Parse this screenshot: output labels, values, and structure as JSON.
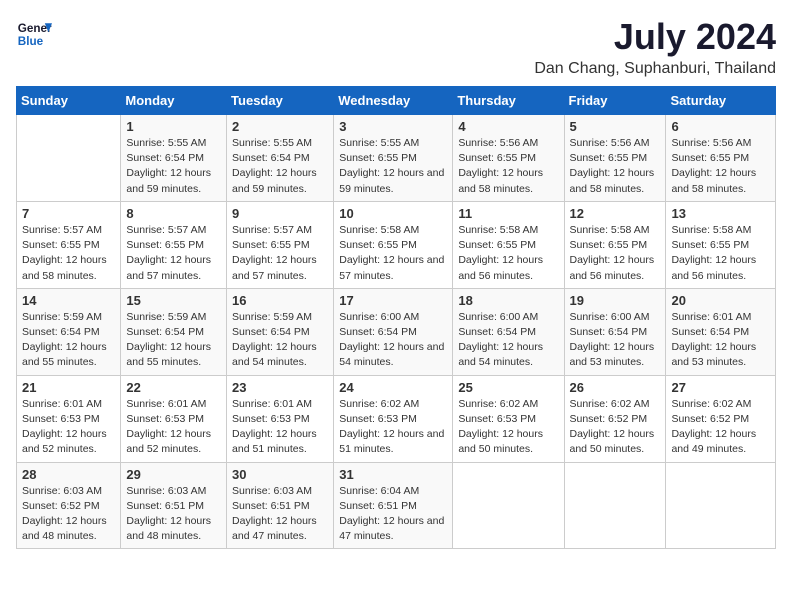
{
  "app": {
    "name_line1": "General",
    "name_line2": "Blue"
  },
  "calendar": {
    "title": "July 2024",
    "location": "Dan Chang, Suphanburi, Thailand",
    "days_of_week": [
      "Sunday",
      "Monday",
      "Tuesday",
      "Wednesday",
      "Thursday",
      "Friday",
      "Saturday"
    ],
    "weeks": [
      [
        {
          "day": "",
          "sunrise": "",
          "sunset": "",
          "daylight": ""
        },
        {
          "day": "1",
          "sunrise": "Sunrise: 5:55 AM",
          "sunset": "Sunset: 6:54 PM",
          "daylight": "Daylight: 12 hours and 59 minutes."
        },
        {
          "day": "2",
          "sunrise": "Sunrise: 5:55 AM",
          "sunset": "Sunset: 6:54 PM",
          "daylight": "Daylight: 12 hours and 59 minutes."
        },
        {
          "day": "3",
          "sunrise": "Sunrise: 5:55 AM",
          "sunset": "Sunset: 6:55 PM",
          "daylight": "Daylight: 12 hours and 59 minutes."
        },
        {
          "day": "4",
          "sunrise": "Sunrise: 5:56 AM",
          "sunset": "Sunset: 6:55 PM",
          "daylight": "Daylight: 12 hours and 58 minutes."
        },
        {
          "day": "5",
          "sunrise": "Sunrise: 5:56 AM",
          "sunset": "Sunset: 6:55 PM",
          "daylight": "Daylight: 12 hours and 58 minutes."
        },
        {
          "day": "6",
          "sunrise": "Sunrise: 5:56 AM",
          "sunset": "Sunset: 6:55 PM",
          "daylight": "Daylight: 12 hours and 58 minutes."
        }
      ],
      [
        {
          "day": "7",
          "sunrise": "Sunrise: 5:57 AM",
          "sunset": "Sunset: 6:55 PM",
          "daylight": "Daylight: 12 hours and 58 minutes."
        },
        {
          "day": "8",
          "sunrise": "Sunrise: 5:57 AM",
          "sunset": "Sunset: 6:55 PM",
          "daylight": "Daylight: 12 hours and 57 minutes."
        },
        {
          "day": "9",
          "sunrise": "Sunrise: 5:57 AM",
          "sunset": "Sunset: 6:55 PM",
          "daylight": "Daylight: 12 hours and 57 minutes."
        },
        {
          "day": "10",
          "sunrise": "Sunrise: 5:58 AM",
          "sunset": "Sunset: 6:55 PM",
          "daylight": "Daylight: 12 hours and 57 minutes."
        },
        {
          "day": "11",
          "sunrise": "Sunrise: 5:58 AM",
          "sunset": "Sunset: 6:55 PM",
          "daylight": "Daylight: 12 hours and 56 minutes."
        },
        {
          "day": "12",
          "sunrise": "Sunrise: 5:58 AM",
          "sunset": "Sunset: 6:55 PM",
          "daylight": "Daylight: 12 hours and 56 minutes."
        },
        {
          "day": "13",
          "sunrise": "Sunrise: 5:58 AM",
          "sunset": "Sunset: 6:55 PM",
          "daylight": "Daylight: 12 hours and 56 minutes."
        }
      ],
      [
        {
          "day": "14",
          "sunrise": "Sunrise: 5:59 AM",
          "sunset": "Sunset: 6:54 PM",
          "daylight": "Daylight: 12 hours and 55 minutes."
        },
        {
          "day": "15",
          "sunrise": "Sunrise: 5:59 AM",
          "sunset": "Sunset: 6:54 PM",
          "daylight": "Daylight: 12 hours and 55 minutes."
        },
        {
          "day": "16",
          "sunrise": "Sunrise: 5:59 AM",
          "sunset": "Sunset: 6:54 PM",
          "daylight": "Daylight: 12 hours and 54 minutes."
        },
        {
          "day": "17",
          "sunrise": "Sunrise: 6:00 AM",
          "sunset": "Sunset: 6:54 PM",
          "daylight": "Daylight: 12 hours and 54 minutes."
        },
        {
          "day": "18",
          "sunrise": "Sunrise: 6:00 AM",
          "sunset": "Sunset: 6:54 PM",
          "daylight": "Daylight: 12 hours and 54 minutes."
        },
        {
          "day": "19",
          "sunrise": "Sunrise: 6:00 AM",
          "sunset": "Sunset: 6:54 PM",
          "daylight": "Daylight: 12 hours and 53 minutes."
        },
        {
          "day": "20",
          "sunrise": "Sunrise: 6:01 AM",
          "sunset": "Sunset: 6:54 PM",
          "daylight": "Daylight: 12 hours and 53 minutes."
        }
      ],
      [
        {
          "day": "21",
          "sunrise": "Sunrise: 6:01 AM",
          "sunset": "Sunset: 6:53 PM",
          "daylight": "Daylight: 12 hours and 52 minutes."
        },
        {
          "day": "22",
          "sunrise": "Sunrise: 6:01 AM",
          "sunset": "Sunset: 6:53 PM",
          "daylight": "Daylight: 12 hours and 52 minutes."
        },
        {
          "day": "23",
          "sunrise": "Sunrise: 6:01 AM",
          "sunset": "Sunset: 6:53 PM",
          "daylight": "Daylight: 12 hours and 51 minutes."
        },
        {
          "day": "24",
          "sunrise": "Sunrise: 6:02 AM",
          "sunset": "Sunset: 6:53 PM",
          "daylight": "Daylight: 12 hours and 51 minutes."
        },
        {
          "day": "25",
          "sunrise": "Sunrise: 6:02 AM",
          "sunset": "Sunset: 6:53 PM",
          "daylight": "Daylight: 12 hours and 50 minutes."
        },
        {
          "day": "26",
          "sunrise": "Sunrise: 6:02 AM",
          "sunset": "Sunset: 6:52 PM",
          "daylight": "Daylight: 12 hours and 50 minutes."
        },
        {
          "day": "27",
          "sunrise": "Sunrise: 6:02 AM",
          "sunset": "Sunset: 6:52 PM",
          "daylight": "Daylight: 12 hours and 49 minutes."
        }
      ],
      [
        {
          "day": "28",
          "sunrise": "Sunrise: 6:03 AM",
          "sunset": "Sunset: 6:52 PM",
          "daylight": "Daylight: 12 hours and 48 minutes."
        },
        {
          "day": "29",
          "sunrise": "Sunrise: 6:03 AM",
          "sunset": "Sunset: 6:51 PM",
          "daylight": "Daylight: 12 hours and 48 minutes."
        },
        {
          "day": "30",
          "sunrise": "Sunrise: 6:03 AM",
          "sunset": "Sunset: 6:51 PM",
          "daylight": "Daylight: 12 hours and 47 minutes."
        },
        {
          "day": "31",
          "sunrise": "Sunrise: 6:04 AM",
          "sunset": "Sunset: 6:51 PM",
          "daylight": "Daylight: 12 hours and 47 minutes."
        },
        {
          "day": "",
          "sunrise": "",
          "sunset": "",
          "daylight": ""
        },
        {
          "day": "",
          "sunrise": "",
          "sunset": "",
          "daylight": ""
        },
        {
          "day": "",
          "sunrise": "",
          "sunset": "",
          "daylight": ""
        }
      ]
    ]
  }
}
